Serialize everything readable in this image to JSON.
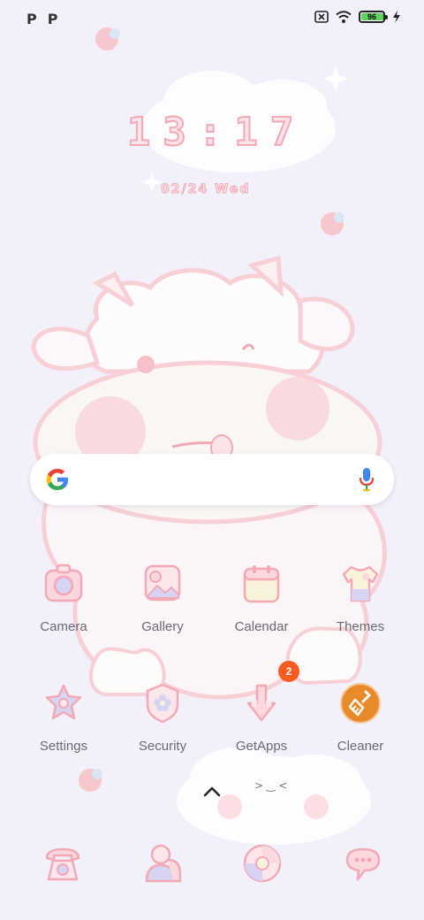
{
  "status_bar": {
    "left_icons": [
      "P",
      "P"
    ],
    "battery_level": "96",
    "battery_fraction": 0.96,
    "icons": [
      "sim-off-icon",
      "wifi-icon",
      "battery-icon",
      "charging-bolt-icon"
    ]
  },
  "clock": {
    "time": "13:17",
    "date": "02/24 Wed"
  },
  "search": {
    "icons": [
      "google-logo-icon",
      "microphone-icon"
    ]
  },
  "apps": {
    "row1": [
      {
        "label": "Camera",
        "icon": "camera-icon"
      },
      {
        "label": "Gallery",
        "icon": "gallery-icon"
      },
      {
        "label": "Calendar",
        "icon": "calendar-icon"
      },
      {
        "label": "Themes",
        "icon": "tshirt-icon"
      }
    ],
    "row2": [
      {
        "label": "Settings",
        "icon": "star-gear-icon"
      },
      {
        "label": "Security",
        "icon": "shield-flower-icon"
      },
      {
        "label": "GetApps",
        "icon": "download-arrow-icon",
        "badge": "2"
      },
      {
        "label": "Cleaner",
        "icon": "broom-icon"
      }
    ]
  },
  "dock": {
    "icons": [
      "phone-icon",
      "contacts-icon",
      "browser-icon",
      "messages-icon"
    ]
  },
  "colors": {
    "background": "#f2f0fb",
    "accent_pink": "#f4a9b5",
    "badge": "#ff5a1f",
    "cleaner": "#e8892a"
  }
}
